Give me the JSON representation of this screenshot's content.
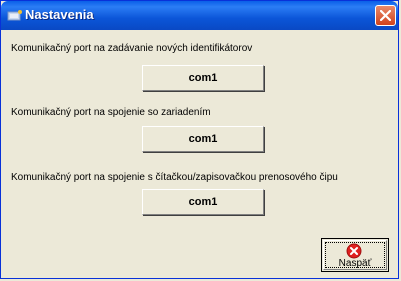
{
  "window": {
    "title": "Nastavenia",
    "title_icon": "settings-app-icon",
    "close_icon": "close-icon",
    "colors": {
      "titlebar": "#0b55d8",
      "close_button": "#d1421c",
      "background": "#ece9d8"
    }
  },
  "sections": [
    {
      "label": "Komunikačný port na zadávanie nových identifikátorov",
      "value": "com1"
    },
    {
      "label": "Komunikačný port na spojenie so zariadením",
      "value": "com1"
    },
    {
      "label": "Komunikačný port na spojenie s čítačkou/zapisovačkou prenosového čipu",
      "value": "com1"
    }
  ],
  "back_button": {
    "label": "Naspäť",
    "icon": "red-x-icon"
  }
}
